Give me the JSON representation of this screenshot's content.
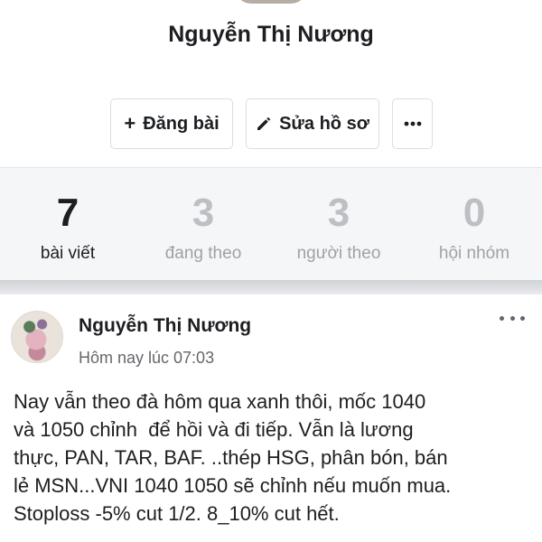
{
  "profile": {
    "name": "Nguyễn Thị Nương"
  },
  "actions": {
    "post_icon": "plus-icon",
    "post_label": "Đăng bài",
    "edit_icon": "pencil-icon",
    "edit_label": "Sửa hồ sơ",
    "more_icon": "ellipsis-icon"
  },
  "stats": [
    {
      "value": "7",
      "label": "bài viết",
      "active": true
    },
    {
      "value": "3",
      "label": "đang theo",
      "active": false
    },
    {
      "value": "3",
      "label": "người theo",
      "active": false
    },
    {
      "value": "0",
      "label": "hội nhóm",
      "active": false
    }
  ],
  "post": {
    "author": "Nguyễn Thị Nương",
    "time": "Hôm nay lúc 07:03",
    "more_icon": "ellipsis-icon",
    "body": "Nay vẫn theo đà hôm qua xanh thôi, mốc 1040\nvà 1050 chỉnh  để hồi và đi tiếp. Vẫn là lương\nthực, PAN, TAR, BAF. ..thép HSG, phân bón, bán\nlẻ MSN...VNI 1040 1050 sẽ chỉnh nếu muốn mua.\nStoploss -5% cut 1/2. 8_10% cut hết."
  },
  "colors": {
    "text": "#1c1e21",
    "muted_number": "#bcc0c4",
    "muted_label": "#9ea2a8",
    "stats_background": "#f5f6f7",
    "time": "#65676b"
  }
}
